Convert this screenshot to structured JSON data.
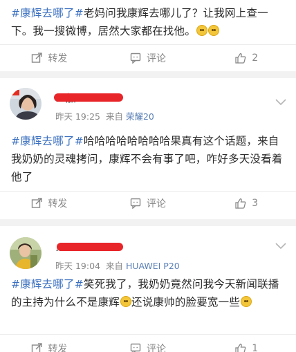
{
  "posts": [
    {
      "text_parts": [
        {
          "tag": "#康辉去哪了#"
        },
        {
          "plain": "老妈问我康辉去哪儿了？让我网上查一下。我一搜微博，居然大家都在找他。"
        }
      ],
      "actions": {
        "repost": "转发",
        "comment": "评论",
        "like_count": "2"
      }
    },
    {
      "author": "…加…",
      "time": "昨天 19:25",
      "from_label": "来自",
      "source": "荣耀20",
      "text_parts": [
        {
          "tag": "#康辉去哪了#"
        },
        {
          "plain": "哈哈哈哈哈哈哈哈果真有这个话题，来自我奶奶的灵魂拷问，康辉不会有事了吧，咋好多天没看着他了"
        }
      ],
      "actions": {
        "repost": "转发",
        "comment": "评论",
        "like_count": "3"
      }
    },
    {
      "author": "…",
      "time": "昨天 19:04",
      "from_label": "来自",
      "source": "HUAWEI P20",
      "text_parts": [
        {
          "tag": "#康辉去哪了#"
        },
        {
          "plain": "笑死我了，我奶奶竟然问我今天新闻联播的主持为什么不是康辉"
        },
        {
          "plain2": "还说康帅的脸要宽一些"
        }
      ],
      "actions": {
        "repost": "转发",
        "comment": "评论",
        "like_count": "1"
      }
    }
  ],
  "colors": {
    "topic": "#3a6fbf",
    "icon": "#888888",
    "redact": "#e8262a"
  },
  "icons": {
    "repost": "repost-icon",
    "comment": "comment-icon",
    "like": "thumbs-up-icon",
    "more": "chevron-down-icon"
  }
}
